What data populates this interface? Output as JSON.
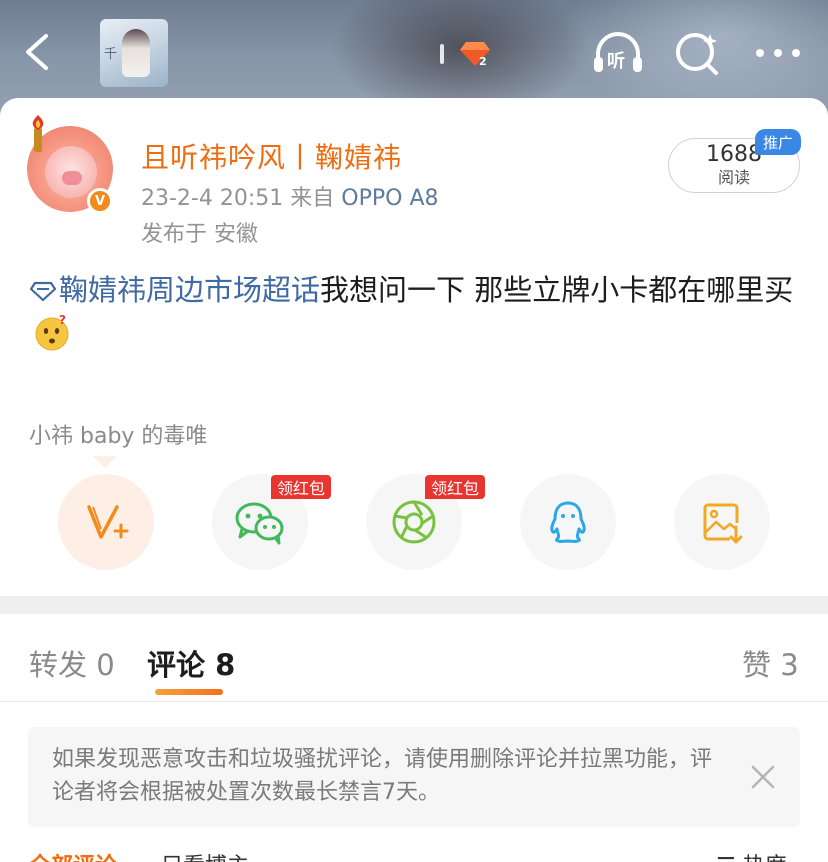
{
  "header": {
    "cover_text": "千",
    "icons": [
      "back-icon",
      "vip-badge-icon",
      "listen-icon",
      "search-icon",
      "more-icon"
    ],
    "listen_label": "听",
    "vip_level": "2"
  },
  "post": {
    "author": "且听祎吟风丨鞠婧祎",
    "verified_badge": "V",
    "time": "23-2-4 20:51",
    "source_prefix": "来自",
    "device": "OPPO A8",
    "location": "发布于 安徽",
    "reads_count": "1688",
    "reads_label": "阅读",
    "promo_tag": "推广",
    "topic": "鞠婧祎周边市场超话",
    "body": "我想问一下 那些立牌小卡都在哪里买"
  },
  "share": {
    "title": "小祎 baby 的毒唯",
    "buttons": [
      {
        "name": "weibo-repost",
        "icon": "weibo-v-plus-icon",
        "color": "#f28a1c",
        "badge": ""
      },
      {
        "name": "wechat",
        "icon": "wechat-icon",
        "color": "#3fb95b",
        "badge": "领红包"
      },
      {
        "name": "moments",
        "icon": "moments-icon",
        "color": "#79c240",
        "badge": "领红包"
      },
      {
        "name": "qq",
        "icon": "qq-icon",
        "color": "#2aa7e6",
        "badge": ""
      },
      {
        "name": "save-image",
        "icon": "save-image-icon",
        "color": "#f3a823",
        "badge": ""
      }
    ]
  },
  "tabs": {
    "repost_label": "转发",
    "repost_count": "0",
    "comment_label": "评论",
    "comment_count": "8",
    "like_label": "赞",
    "like_count": "3"
  },
  "notice": {
    "text": "如果发现恶意攻击和垃圾骚扰评论，请使用删除评论并拉黑功能，评论者将会根据被处置次数最长禁言7天。"
  },
  "comment_filters": {
    "all": "全部评论",
    "author_only": "只看博主",
    "sort": "热度"
  },
  "colors": {
    "accent_orange": "#f06c10",
    "link_blue": "#3f6aa3",
    "red_badge": "#e8352f"
  }
}
